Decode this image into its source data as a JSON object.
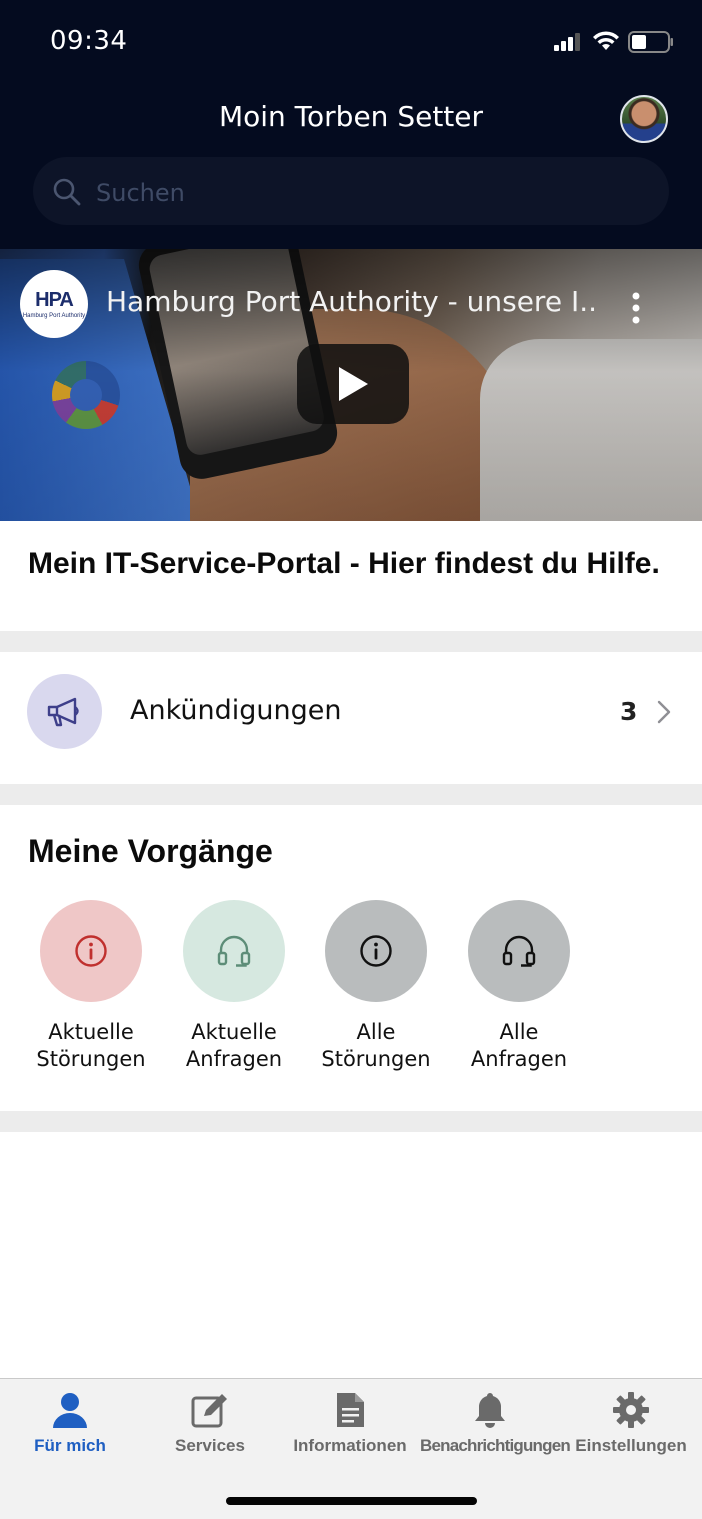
{
  "status_bar": {
    "time": "09:34"
  },
  "header": {
    "greeting": "Moin Torben Setter"
  },
  "search": {
    "placeholder": "Suchen"
  },
  "video": {
    "channel_logo_text": "HPA",
    "channel_logo_subtext": "Hamburg Port Authority",
    "title": "Hamburg Port Authority - unsere I..."
  },
  "portal": {
    "title": "Mein IT-Service-Portal - Hier findest du Hilfe."
  },
  "announcements": {
    "label": "Ankündigungen",
    "count": "3"
  },
  "processes": {
    "title": "Meine Vorgänge",
    "items": [
      {
        "line1": "Aktuelle",
        "line2": "Störungen",
        "icon": "info-icon",
        "bg": "#efc7c7",
        "fg": "#c0302e"
      },
      {
        "line1": "Aktuelle",
        "line2": "Anfragen",
        "icon": "headset-icon",
        "bg": "#d6e8e0",
        "fg": "#5d8d78"
      },
      {
        "line1": "Alle",
        "line2": "Störungen",
        "icon": "info-icon",
        "bg": "#b9bcbd",
        "fg": "#111111"
      },
      {
        "line1": "Alle",
        "line2": "Anfragen",
        "icon": "headset-icon",
        "bg": "#b9bcbd",
        "fg": "#111111"
      }
    ]
  },
  "tabbar": {
    "tabs": [
      {
        "label": "Für mich",
        "icon": "person-icon",
        "active": true
      },
      {
        "label": "Services",
        "icon": "edit-icon",
        "active": false
      },
      {
        "label": "Informationen",
        "icon": "document-icon",
        "active": false
      },
      {
        "label": "Benachrichtigungen",
        "icon": "bell-icon",
        "active": false
      },
      {
        "label": "Einstellungen",
        "icon": "gear-icon",
        "active": false
      }
    ]
  },
  "colors": {
    "header_bg": "#040b1f",
    "accent": "#1f5fc2",
    "tab_inactive": "#6a6a6a"
  }
}
